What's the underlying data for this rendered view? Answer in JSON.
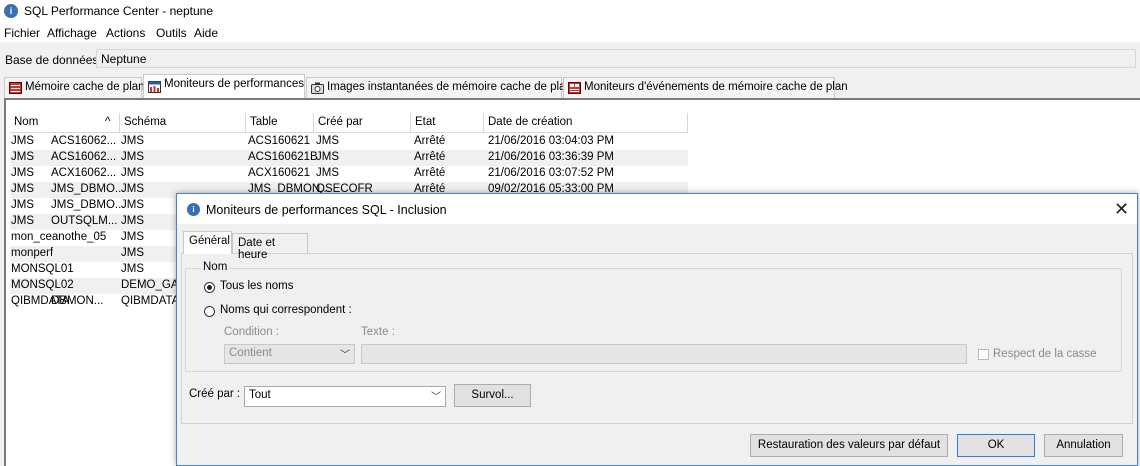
{
  "window": {
    "title": "SQL Performance Center - neptune"
  },
  "menu": [
    "Fichier",
    "Affichage",
    "Actions",
    "Outils",
    "Aide"
  ],
  "database": {
    "label": "Base de données :",
    "value": "Neptune"
  },
  "tabs": [
    {
      "label": "Mémoire cache de plan",
      "icon": "plan-cache-icon"
    },
    {
      "label": "Moniteurs de performances",
      "icon": "performance-monitor-icon",
      "active": true
    },
    {
      "label": "Images instantanées de mémoire cache de plan",
      "icon": "camera-icon"
    },
    {
      "label": "Moniteurs d'événements de mémoire cache de plan",
      "icon": "event-monitor-icon"
    }
  ],
  "table": {
    "columns": [
      "Nom",
      "Schéma",
      "Table",
      "Créé par",
      "Etat",
      "Date de création"
    ],
    "sort_indicator": "^",
    "rows": [
      {
        "nom_a": "JMS",
        "nom_b": "ACS16062...",
        "schema": "JMS",
        "table": "ACS160621",
        "cree_par": "JMS",
        "etat": "Arrêté",
        "date": "21/06/2016 03:04:03 PM"
      },
      {
        "nom_a": "JMS",
        "nom_b": "ACS16062...",
        "schema": "JMS",
        "table": "ACS160621B",
        "cree_par": "JMS",
        "etat": "Arrêté",
        "date": "21/06/2016 03:36:39 PM"
      },
      {
        "nom_a": "JMS",
        "nom_b": "ACX16062...",
        "schema": "JMS",
        "table": "ACX160621",
        "cree_par": "JMS",
        "etat": "Arrêté",
        "date": "21/06/2016 03:07:52 PM"
      },
      {
        "nom_a": "JMS",
        "nom_b": "JMS_DBMO...",
        "schema": "JMS",
        "table": "JMS_DBMON...",
        "cree_par": "QSECOFR",
        "etat": "Arrêté",
        "date": "09/02/2016 05:33:00 PM"
      },
      {
        "nom_a": "JMS",
        "nom_b": "JMS_DBMO...",
        "schema": "JMS",
        "table": "",
        "cree_par": "",
        "etat": "",
        "date": ""
      },
      {
        "nom_a": "JMS",
        "nom_b": "OUTSQLM...",
        "schema": "JMS",
        "table": "",
        "cree_par": "",
        "etat": "",
        "date": ""
      },
      {
        "nom_a": "mon_ceanothe_05",
        "nom_b": "",
        "schema": "JMS",
        "table": "",
        "cree_par": "",
        "etat": "",
        "date": ""
      },
      {
        "nom_a": "monperf",
        "nom_b": "",
        "schema": "JMS",
        "table": "",
        "cree_par": "",
        "etat": "",
        "date": ""
      },
      {
        "nom_a": "MONSQL01",
        "nom_b": "",
        "schema": "JMS",
        "table": "",
        "cree_par": "",
        "etat": "",
        "date": ""
      },
      {
        "nom_a": "MONSQL02",
        "nom_b": "",
        "schema": "DEMO_GAIA",
        "table": "",
        "cree_par": "",
        "etat": "",
        "date": ""
      },
      {
        "nom_a": "QIBMDATA",
        "nom_b": "DBMON...",
        "schema": "QIBMDATA",
        "table": "",
        "cree_par": "",
        "etat": "",
        "date": ""
      }
    ]
  },
  "dialog": {
    "title": "Moniteurs de performances SQL - Inclusion",
    "tabs": [
      "Général",
      "Date et heure"
    ],
    "group_label": "Nom",
    "radio_all": "Tous les noms",
    "radio_match": "Noms qui correspondent :",
    "condition_label": "Condition :",
    "condition_value": "Contient",
    "text_label": "Texte :",
    "text_value": "",
    "case_label": "Respect de la casse",
    "created_by_label": "Créé par :",
    "created_by_value": "Tout",
    "browse_button": "Survol...",
    "restore_button": "Restauration des valeurs par défaut",
    "ok_button": "OK",
    "cancel_button": "Annulation"
  }
}
